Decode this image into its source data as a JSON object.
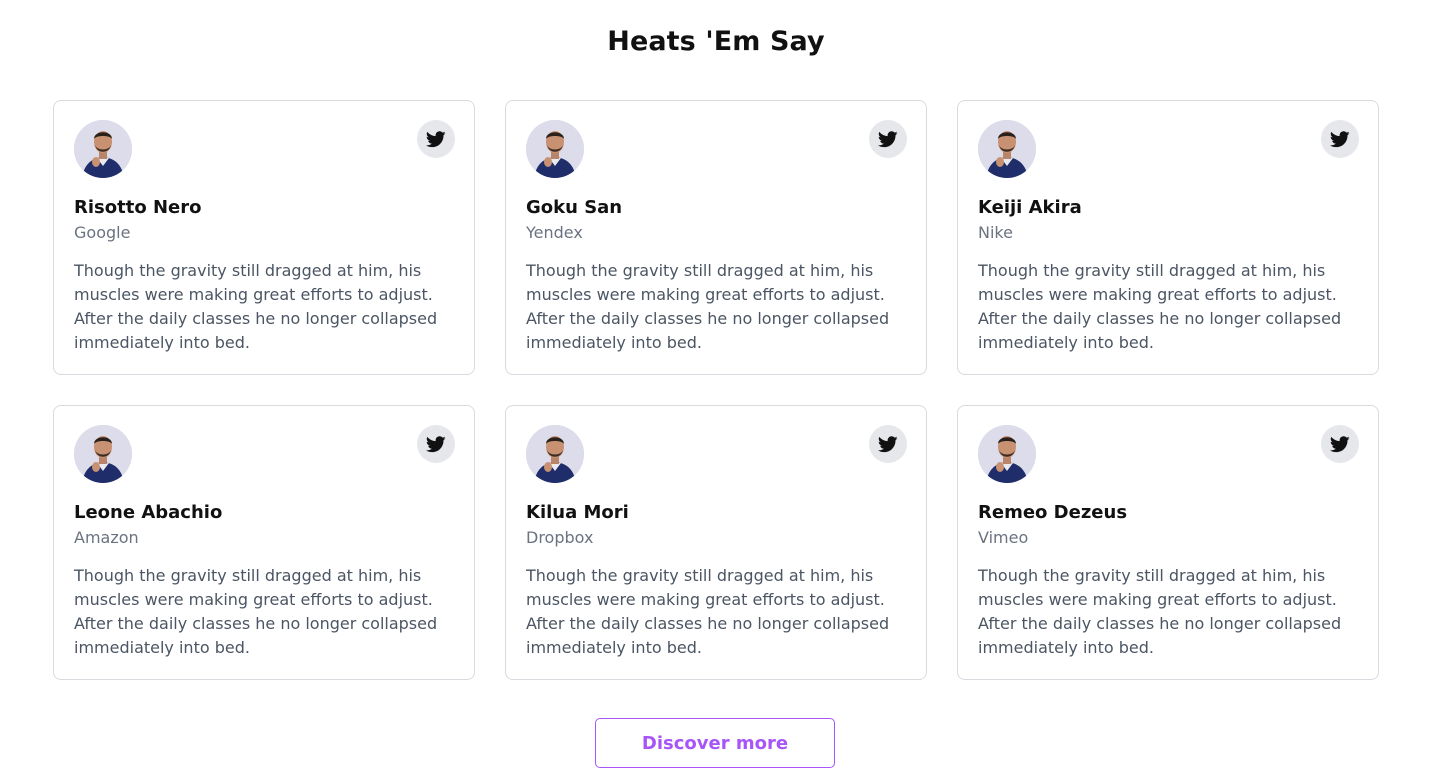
{
  "section": {
    "title": "Heats 'Em Say"
  },
  "testimonials": [
    {
      "name": "Risotto Nero",
      "company": "Google",
      "quote": "Though the gravity still dragged at him, his muscles were making great efforts to adjust. After the daily classes he no longer collapsed immediately into bed.",
      "social_icon": "twitter-icon"
    },
    {
      "name": "Goku San",
      "company": "Yendex",
      "quote": "Though the gravity still dragged at him, his muscles were making great efforts to adjust. After the daily classes he no longer collapsed immediately into bed.",
      "social_icon": "twitter-icon"
    },
    {
      "name": "Keiji Akira",
      "company": "Nike",
      "quote": "Though the gravity still dragged at him, his muscles were making great efforts to adjust. After the daily classes he no longer collapsed immediately into bed.",
      "social_icon": "twitter-icon"
    },
    {
      "name": "Leone Abachio",
      "company": "Amazon",
      "quote": "Though the gravity still dragged at him, his muscles were making great efforts to adjust. After the daily classes he no longer collapsed immediately into bed.",
      "social_icon": "twitter-icon"
    },
    {
      "name": "Kilua Mori",
      "company": "Dropbox",
      "quote": "Though the gravity still dragged at him, his muscles were making great efforts to adjust. After the daily classes he no longer collapsed immediately into bed.",
      "social_icon": "twitter-icon"
    },
    {
      "name": "Remeo Dezeus",
      "company": "Vimeo",
      "quote": "Though the gravity still dragged at him, his muscles were making great efforts to adjust. After the daily classes he no longer collapsed immediately into bed.",
      "social_icon": "twitter-icon"
    }
  ],
  "actions": {
    "discover_label": "Discover more"
  },
  "colors": {
    "accent": "#a855f7",
    "card_border": "#d9dbe0",
    "icon_bg": "#e6e7eb",
    "muted_text": "#6b7280",
    "body_text": "#4b5563"
  }
}
